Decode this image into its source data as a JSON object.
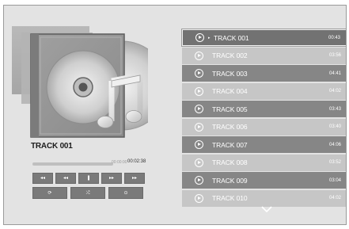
{
  "now_playing": {
    "title": "TRACK 001",
    "current_time": "00:00:00",
    "total_time": "00:02:38",
    "progress": 0.0
  },
  "controls": {
    "row1": [
      {
        "name": "skip-back-button",
        "glyph": "◂◂"
      },
      {
        "name": "rewind-button",
        "glyph": "◂◂"
      },
      {
        "name": "pause-button",
        "glyph": "❚"
      },
      {
        "name": "fast-forward-button",
        "glyph": "▸▸"
      },
      {
        "name": "skip-forward-button",
        "glyph": "▸▸"
      }
    ],
    "row2": [
      {
        "name": "repeat-button",
        "glyph": "⟳"
      },
      {
        "name": "shuffle-button",
        "glyph": "⤮"
      },
      {
        "name": "options-button",
        "glyph": "⊙"
      }
    ]
  },
  "tracks": [
    {
      "name": "TRACK 001",
      "duration": "00:43",
      "selected": true,
      "playing": true
    },
    {
      "name": "TRACK 002",
      "duration": "03:56"
    },
    {
      "name": "TRACK 003",
      "duration": "04:41"
    },
    {
      "name": "TRACK 004",
      "duration": "04:02"
    },
    {
      "name": "TRACK 005",
      "duration": "03:43"
    },
    {
      "name": "TRACK 006",
      "duration": "03:40"
    },
    {
      "name": "TRACK 007",
      "duration": "04:06"
    },
    {
      "name": "TRACK 008",
      "duration": "03:52"
    },
    {
      "name": "TRACK 009",
      "duration": "03:04"
    },
    {
      "name": "TRACK 010",
      "duration": "04:02"
    }
  ],
  "icons": {
    "album_art": "music-album-icon",
    "row_play": "play-circle-icon",
    "scroll_more": "chevron-down-icon"
  },
  "colors": {
    "background": "#e3e3e3",
    "row_dark": "#868686",
    "row_light": "#c6c6c6",
    "selected_row": "#727272"
  }
}
